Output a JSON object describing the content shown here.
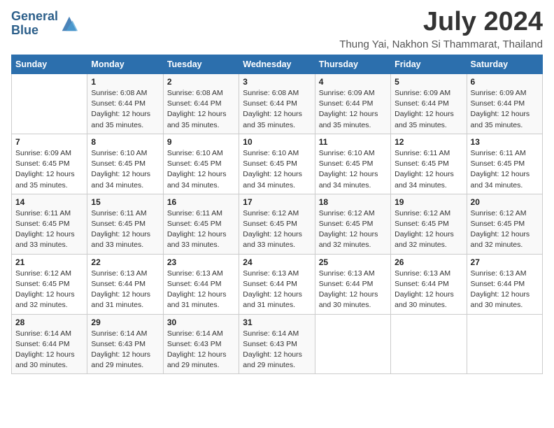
{
  "header": {
    "logo_line1": "General",
    "logo_line2": "Blue",
    "main_title": "July 2024",
    "subtitle": "Thung Yai, Nakhon Si Thammarat, Thailand"
  },
  "weekdays": [
    "Sunday",
    "Monday",
    "Tuesday",
    "Wednesday",
    "Thursday",
    "Friday",
    "Saturday"
  ],
  "weeks": [
    [
      {
        "day": "",
        "info": ""
      },
      {
        "day": "1",
        "info": "Sunrise: 6:08 AM\nSunset: 6:44 PM\nDaylight: 12 hours\nand 35 minutes."
      },
      {
        "day": "2",
        "info": "Sunrise: 6:08 AM\nSunset: 6:44 PM\nDaylight: 12 hours\nand 35 minutes."
      },
      {
        "day": "3",
        "info": "Sunrise: 6:08 AM\nSunset: 6:44 PM\nDaylight: 12 hours\nand 35 minutes."
      },
      {
        "day": "4",
        "info": "Sunrise: 6:09 AM\nSunset: 6:44 PM\nDaylight: 12 hours\nand 35 minutes."
      },
      {
        "day": "5",
        "info": "Sunrise: 6:09 AM\nSunset: 6:44 PM\nDaylight: 12 hours\nand 35 minutes."
      },
      {
        "day": "6",
        "info": "Sunrise: 6:09 AM\nSunset: 6:44 PM\nDaylight: 12 hours\nand 35 minutes."
      }
    ],
    [
      {
        "day": "7",
        "info": "Sunrise: 6:09 AM\nSunset: 6:45 PM\nDaylight: 12 hours\nand 35 minutes."
      },
      {
        "day": "8",
        "info": "Sunrise: 6:10 AM\nSunset: 6:45 PM\nDaylight: 12 hours\nand 34 minutes."
      },
      {
        "day": "9",
        "info": "Sunrise: 6:10 AM\nSunset: 6:45 PM\nDaylight: 12 hours\nand 34 minutes."
      },
      {
        "day": "10",
        "info": "Sunrise: 6:10 AM\nSunset: 6:45 PM\nDaylight: 12 hours\nand 34 minutes."
      },
      {
        "day": "11",
        "info": "Sunrise: 6:10 AM\nSunset: 6:45 PM\nDaylight: 12 hours\nand 34 minutes."
      },
      {
        "day": "12",
        "info": "Sunrise: 6:11 AM\nSunset: 6:45 PM\nDaylight: 12 hours\nand 34 minutes."
      },
      {
        "day": "13",
        "info": "Sunrise: 6:11 AM\nSunset: 6:45 PM\nDaylight: 12 hours\nand 34 minutes."
      }
    ],
    [
      {
        "day": "14",
        "info": "Sunrise: 6:11 AM\nSunset: 6:45 PM\nDaylight: 12 hours\nand 33 minutes."
      },
      {
        "day": "15",
        "info": "Sunrise: 6:11 AM\nSunset: 6:45 PM\nDaylight: 12 hours\nand 33 minutes."
      },
      {
        "day": "16",
        "info": "Sunrise: 6:11 AM\nSunset: 6:45 PM\nDaylight: 12 hours\nand 33 minutes."
      },
      {
        "day": "17",
        "info": "Sunrise: 6:12 AM\nSunset: 6:45 PM\nDaylight: 12 hours\nand 33 minutes."
      },
      {
        "day": "18",
        "info": "Sunrise: 6:12 AM\nSunset: 6:45 PM\nDaylight: 12 hours\nand 32 minutes."
      },
      {
        "day": "19",
        "info": "Sunrise: 6:12 AM\nSunset: 6:45 PM\nDaylight: 12 hours\nand 32 minutes."
      },
      {
        "day": "20",
        "info": "Sunrise: 6:12 AM\nSunset: 6:45 PM\nDaylight: 12 hours\nand 32 minutes."
      }
    ],
    [
      {
        "day": "21",
        "info": "Sunrise: 6:12 AM\nSunset: 6:45 PM\nDaylight: 12 hours\nand 32 minutes."
      },
      {
        "day": "22",
        "info": "Sunrise: 6:13 AM\nSunset: 6:44 PM\nDaylight: 12 hours\nand 31 minutes."
      },
      {
        "day": "23",
        "info": "Sunrise: 6:13 AM\nSunset: 6:44 PM\nDaylight: 12 hours\nand 31 minutes."
      },
      {
        "day": "24",
        "info": "Sunrise: 6:13 AM\nSunset: 6:44 PM\nDaylight: 12 hours\nand 31 minutes."
      },
      {
        "day": "25",
        "info": "Sunrise: 6:13 AM\nSunset: 6:44 PM\nDaylight: 12 hours\nand 30 minutes."
      },
      {
        "day": "26",
        "info": "Sunrise: 6:13 AM\nSunset: 6:44 PM\nDaylight: 12 hours\nand 30 minutes."
      },
      {
        "day": "27",
        "info": "Sunrise: 6:13 AM\nSunset: 6:44 PM\nDaylight: 12 hours\nand 30 minutes."
      }
    ],
    [
      {
        "day": "28",
        "info": "Sunrise: 6:14 AM\nSunset: 6:44 PM\nDaylight: 12 hours\nand 30 minutes."
      },
      {
        "day": "29",
        "info": "Sunrise: 6:14 AM\nSunset: 6:43 PM\nDaylight: 12 hours\nand 29 minutes."
      },
      {
        "day": "30",
        "info": "Sunrise: 6:14 AM\nSunset: 6:43 PM\nDaylight: 12 hours\nand 29 minutes."
      },
      {
        "day": "31",
        "info": "Sunrise: 6:14 AM\nSunset: 6:43 PM\nDaylight: 12 hours\nand 29 minutes."
      },
      {
        "day": "",
        "info": ""
      },
      {
        "day": "",
        "info": ""
      },
      {
        "day": "",
        "info": ""
      }
    ]
  ]
}
